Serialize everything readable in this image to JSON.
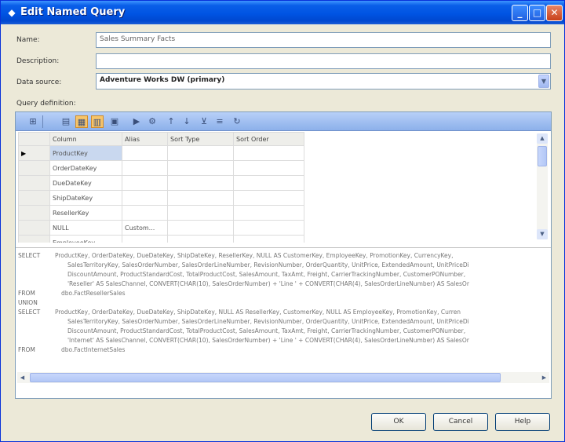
{
  "window": {
    "title": "Edit Named Query"
  },
  "form": {
    "name_label": "Name:",
    "name_value": "Sales Summary Facts",
    "description_label": "Description:",
    "description_value": "",
    "datasource_label": "Data source:",
    "datasource_value": "Adventure Works DW (primary)",
    "query_label": "Query definition:"
  },
  "grid": {
    "columns": [
      "Column",
      "Alias",
      "Sort Type",
      "Sort Order"
    ],
    "rows": [
      {
        "column": "ProductKey",
        "alias": "",
        "sort_type": "",
        "sort_order": ""
      },
      {
        "column": "OrderDateKey",
        "alias": "",
        "sort_type": "",
        "sort_order": ""
      },
      {
        "column": "DueDateKey",
        "alias": "",
        "sort_type": "",
        "sort_order": ""
      },
      {
        "column": "ShipDateKey",
        "alias": "",
        "sort_type": "",
        "sort_order": ""
      },
      {
        "column": "ResellerKey",
        "alias": "",
        "sort_type": "",
        "sort_order": ""
      },
      {
        "column": "NULL",
        "alias": "Custom...",
        "sort_type": "",
        "sort_order": ""
      },
      {
        "column": "EmployeeKey",
        "alias": "",
        "sort_type": "",
        "sort_order": ""
      }
    ]
  },
  "sql": {
    "lines": [
      {
        "kw": "SELECT",
        "text": "ProductKey, OrderDateKey, DueDateKey, ShipDateKey, ResellerKey, NULL AS CustomerKey, EmployeeKey, PromotionKey, CurrencyKey,"
      },
      {
        "kw": "",
        "text": "SalesTerritoryKey, SalesOrderNumber, SalesOrderLineNumber, RevisionNumber, OrderQuantity, UnitPrice, ExtendedAmount, UnitPriceDi"
      },
      {
        "kw": "",
        "text": "DiscountAmount, ProductStandardCost, TotalProductCost, SalesAmount, TaxAmt, Freight, CarrierTrackingNumber, CustomerPONumber,"
      },
      {
        "kw": "",
        "text": "'Reseller' AS SalesChannel, CONVERT(CHAR(10), SalesOrderNumber) + 'Line ' + CONVERT(CHAR(4), SalesOrderLineNumber) AS SalesOr"
      },
      {
        "kw": "FROM",
        "text": "dbo.FactResellerSales"
      },
      {
        "kw": "UNION",
        "text": ""
      },
      {
        "kw": "SELECT",
        "text": "ProductKey, OrderDateKey, DueDateKey, ShipDateKey, NULL AS ResellerKey, CustomerKey, NULL AS EmployeeKey, PromotionKey, Curren"
      },
      {
        "kw": "",
        "text": "SalesTerritoryKey, SalesOrderNumber, SalesOrderLineNumber, RevisionNumber, OrderQuantity, UnitPrice, ExtendedAmount, UnitPriceDi"
      },
      {
        "kw": "",
        "text": "DiscountAmount, ProductStandardCost, TotalProductCost, SalesAmount, TaxAmt, Freight, CarrierTrackingNumber, CustomerPONumber,"
      },
      {
        "kw": "",
        "text": "'Internet' AS SalesChannel, CONVERT(CHAR(10), SalesOrderNumber) + 'Line ' + CONVERT(CHAR(4), SalesOrderLineNumber) AS SalesOr"
      },
      {
        "kw": "FROM",
        "text": "dbo.FactInternetSales"
      }
    ]
  },
  "buttons": {
    "ok": "OK",
    "cancel": "Cancel",
    "help": "Help"
  }
}
